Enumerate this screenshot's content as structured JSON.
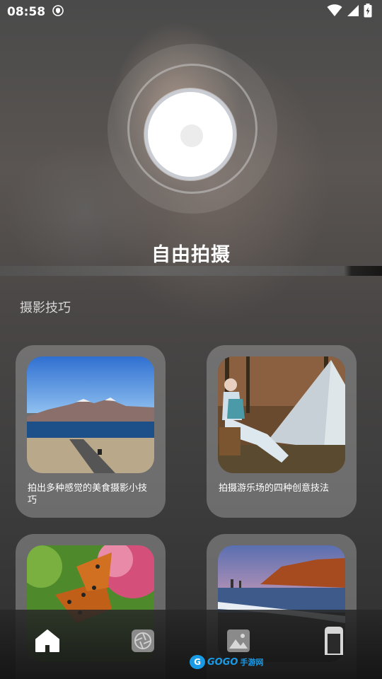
{
  "status_bar": {
    "time": "08:58",
    "icons": [
      "shield-app-icon",
      "wifi-icon",
      "signal-icon",
      "battery-charging-icon"
    ]
  },
  "camera": {
    "mode_title": "自由拍摄"
  },
  "tips": {
    "section_title": "摄影技巧",
    "cards": [
      {
        "caption": "拍出多种感觉的美食摄影小技巧",
        "image": "mountain-lake-road-photo"
      },
      {
        "caption": "拍摄游乐场的四种创意技法",
        "image": "woman-beside-tent-photo"
      },
      {
        "caption": "",
        "image": "butterfly-flower-photo"
      },
      {
        "caption": "",
        "image": "coastal-cliff-sunset-photo"
      }
    ]
  },
  "bottom_nav": {
    "items": [
      {
        "name": "home",
        "icon": "home-icon",
        "active": true
      },
      {
        "name": "camera",
        "icon": "aperture-icon",
        "active": false
      },
      {
        "name": "gallery",
        "icon": "image-icon",
        "active": false
      },
      {
        "name": "profile",
        "icon": "phone-icon",
        "active": false
      }
    ]
  },
  "watermark": {
    "brand": "GOGO",
    "suffix": "手游网"
  },
  "colors": {
    "accent": "#1a9be6",
    "card_bg": "#969696",
    "shutter_ring": "#c9ccd2"
  }
}
